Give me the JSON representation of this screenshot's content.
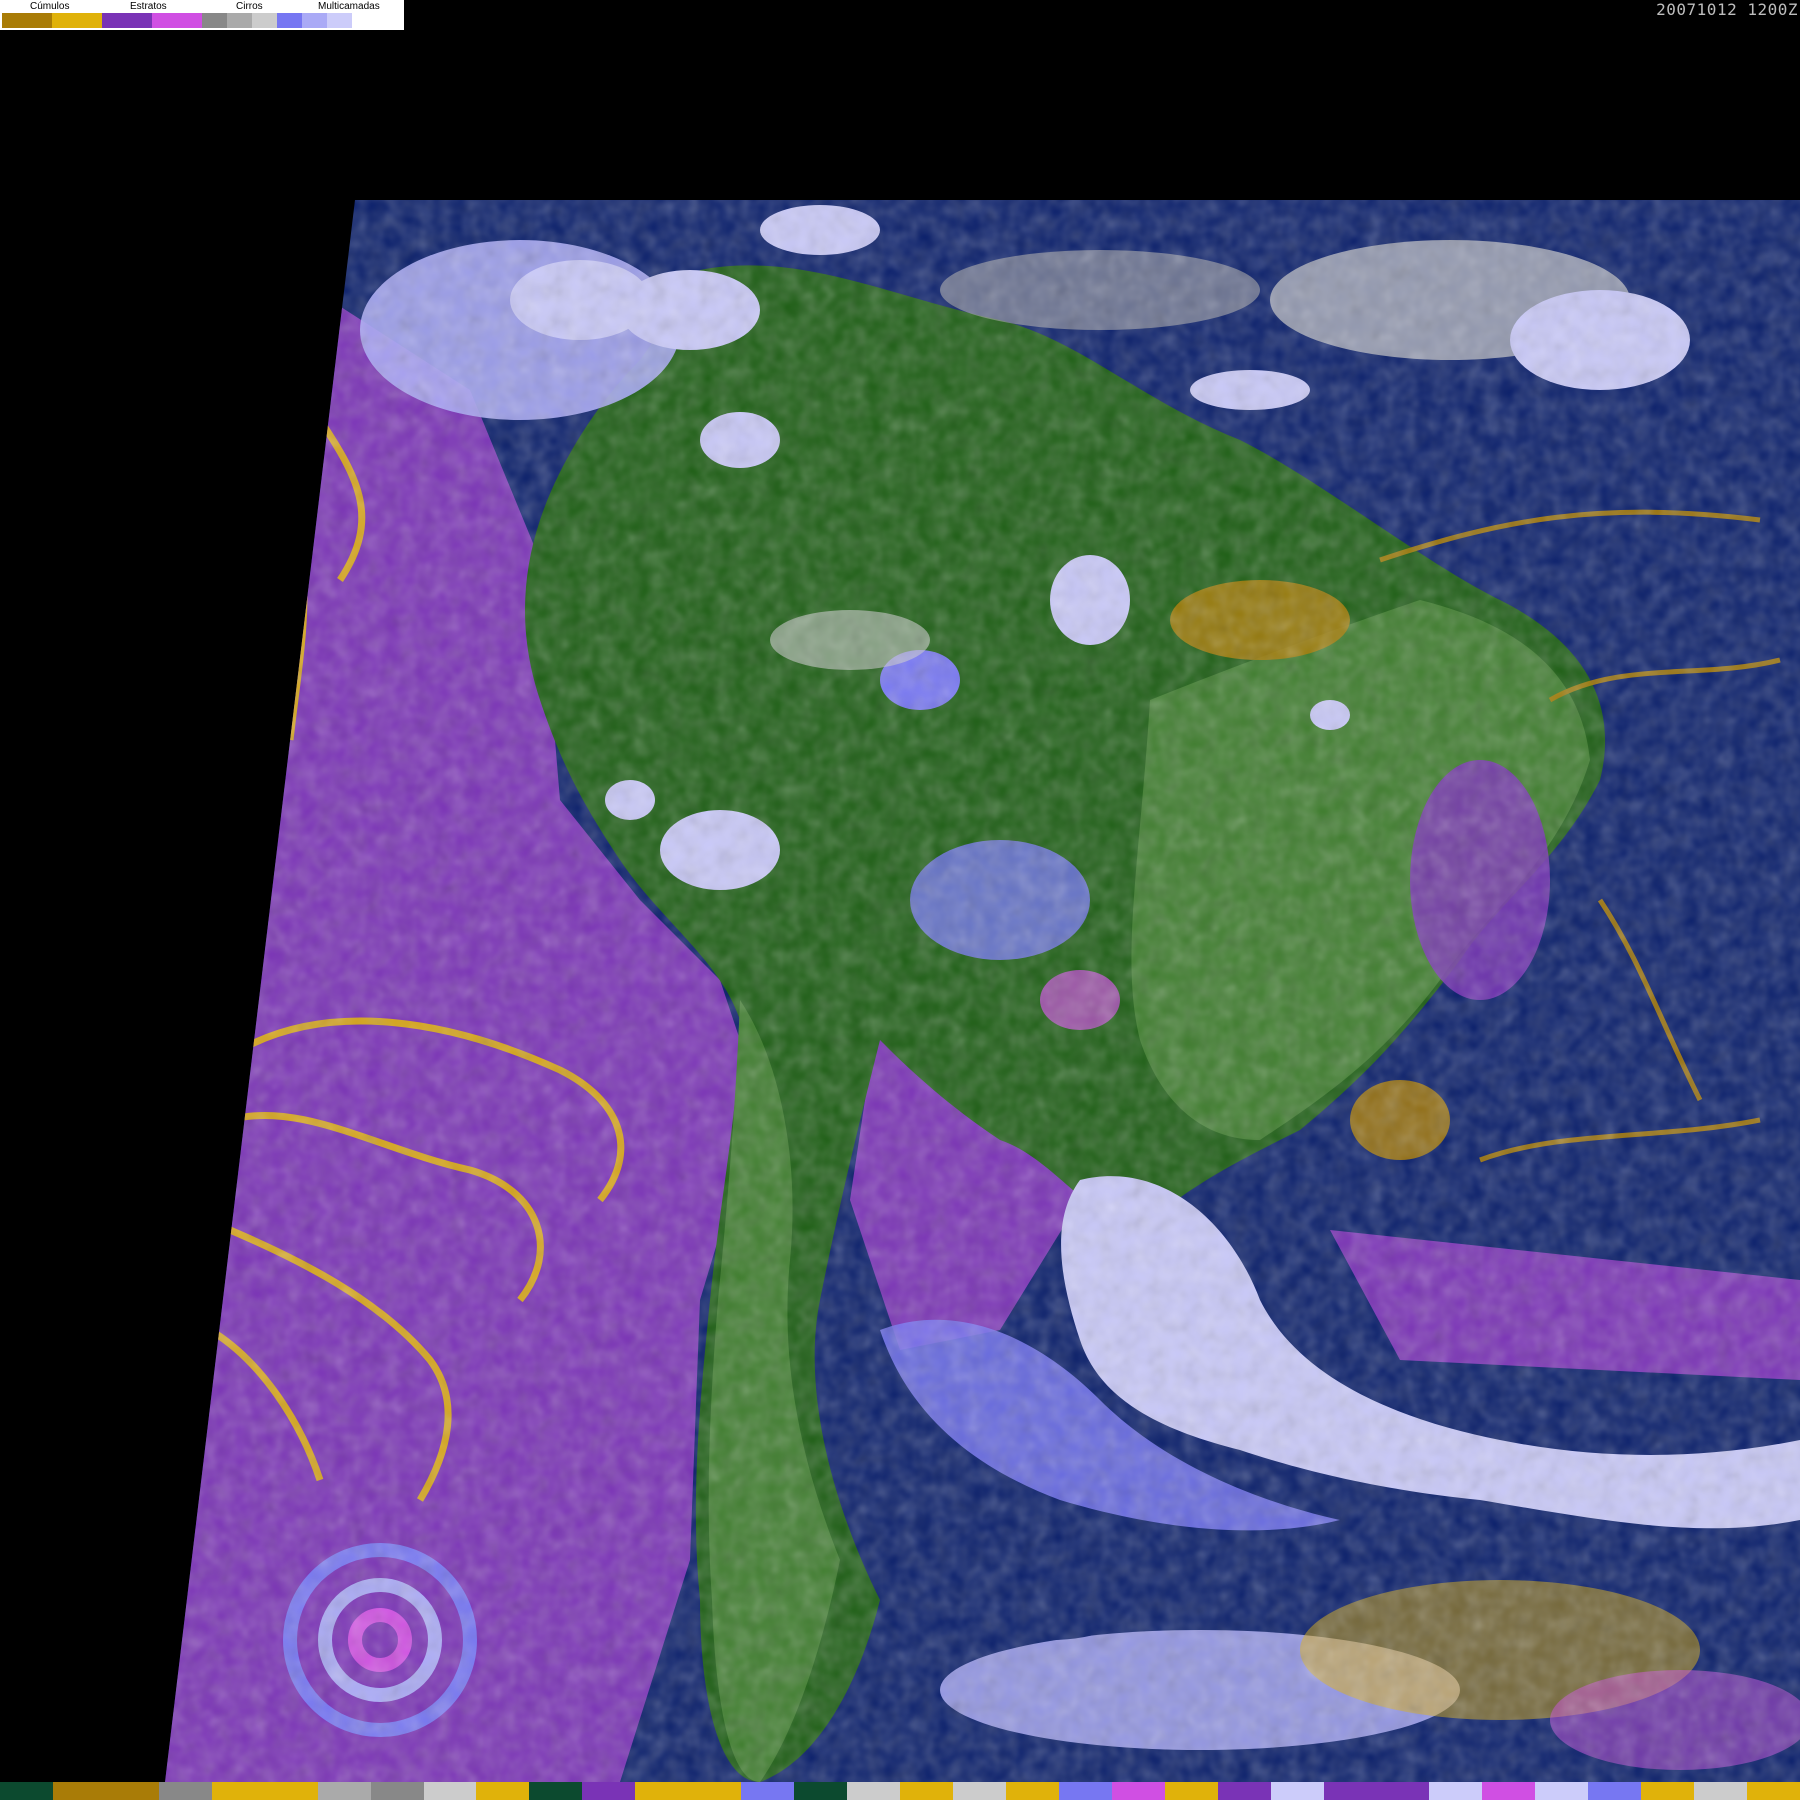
{
  "legend": {
    "categories": [
      {
        "label": "Cúmulos",
        "colors": [
          "#a97c07",
          "#e0b20a"
        ]
      },
      {
        "label": "Estratos",
        "colors": [
          "#7a33b6",
          "#d04fe3"
        ]
      },
      {
        "label": "Cirros",
        "colors": [
          "#888888",
          "#aaaaaa",
          "#cccccc"
        ]
      },
      {
        "label": "Multicamadas",
        "colors": [
          "#7777f2",
          "#aaaaf6",
          "#ccccfa"
        ]
      }
    ]
  },
  "timestamp": "20071012 1200Z",
  "map": {
    "colors": {
      "ocean": "#0a1f6b",
      "land": "#1d5e14",
      "land_light": "#3f7d2e",
      "cumulus": "#e0b20a",
      "cumulus_dark": "#a97c07",
      "stratus": "#7a33b6",
      "stratus_light": "#d04fe3",
      "cirrus": "#aaaaaa",
      "multilayer": "#7777f2",
      "multilayer_light": "#c8c8f8"
    }
  },
  "bottom_bar": {
    "colors": [
      "#0c4a2f",
      "#a97c07",
      "#a97c07",
      "#888888",
      "#e0b20a",
      "#e0b20a",
      "#aaaaaa",
      "#888888",
      "#cccccc",
      "#e0b20a",
      "#0c4a2f",
      "#7a33b6",
      "#e0b20a",
      "#e0b20a",
      "#7777f2",
      "#0c4a2f",
      "#cccccc",
      "#e0b20a",
      "#cccccc",
      "#e0b20a",
      "#7777f2",
      "#d04fe3",
      "#e0b20a",
      "#7a33b6",
      "#ccccfa",
      "#7a33b6",
      "#7a33b6",
      "#ccccfa",
      "#d04fe3",
      "#ccccfa",
      "#7777f2",
      "#e0b20a",
      "#cccccc",
      "#e0b20a"
    ]
  }
}
